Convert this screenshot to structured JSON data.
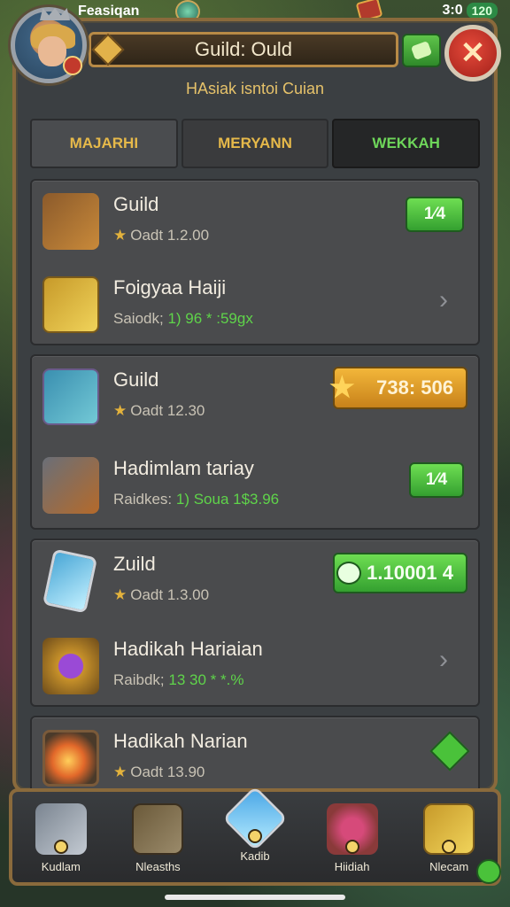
{
  "status_bar": {
    "carrier": "Feasiqan",
    "time": "3:0",
    "battery": "120"
  },
  "header": {
    "title": "Guild: Ould",
    "subtitle": "HAsiak isntoi Cuian"
  },
  "tabs": [
    {
      "label": "MAJARHI",
      "active": false
    },
    {
      "label": "MERYANN",
      "active": false
    },
    {
      "label": "WEKKAH",
      "active": true
    }
  ],
  "cards": [
    {
      "rows": [
        {
          "icon": "weapon-icon",
          "title": "Guild",
          "sub_prefix": "Oadt 1.2.00",
          "sub_green": "",
          "action": "1⁄4",
          "action_type": "green-button"
        },
        {
          "icon": "chest-icon",
          "title": "Foigyaa Haiji",
          "sub_prefix": "Saiodk; ",
          "sub_green": "1) 96 * :59gx",
          "action": "›",
          "action_type": "chevron"
        }
      ]
    },
    {
      "rows": [
        {
          "icon": "hero-icon",
          "title": "Guild",
          "sub_prefix": "Oadt 12.30",
          "sub_green": "",
          "action": "738: 506",
          "action_type": "gold-button"
        },
        {
          "icon": "sword-icon",
          "title": "Hadimlam tariay",
          "sub_prefix": "Raidkes: ",
          "sub_green": "1) Soua 1$3.96",
          "action": "1⁄4",
          "action_type": "green-button"
        }
      ]
    },
    {
      "rows": [
        {
          "icon": "card-icon",
          "title": "Zuild",
          "sub_prefix": "Oadt 1.3.00",
          "sub_green": "",
          "action": "1.10001 4",
          "action_type": "green-wide-button"
        },
        {
          "icon": "orb-icon",
          "title": "Hadikah Hariaian",
          "sub_prefix": "Raibdk; ",
          "sub_green": "13 30 * *.%",
          "action": "›",
          "action_type": "chevron"
        }
      ]
    },
    {
      "rows": [
        {
          "icon": "fire-icon",
          "title": "Hadikah Narian",
          "sub_prefix": "Oadt 13.90",
          "sub_green": "",
          "action": "",
          "action_type": "diamond-button"
        }
      ]
    }
  ],
  "bottom_nav": [
    {
      "label": "Kudlam",
      "icon": "knight-icon"
    },
    {
      "label": "Nleasths",
      "icon": "book-icon"
    },
    {
      "label": "Kadib",
      "icon": "crystal-icon"
    },
    {
      "label": "Hiidiah",
      "icon": "heart-chest-icon"
    },
    {
      "label": "Nlecam",
      "icon": "chest-icon"
    }
  ],
  "colors": {
    "panel": "#3b3f42",
    "border_gold": "#8a6a3c",
    "accent_green": "#5fd44a",
    "accent_gold": "#e6b94a",
    "close_red": "#c8322a"
  }
}
